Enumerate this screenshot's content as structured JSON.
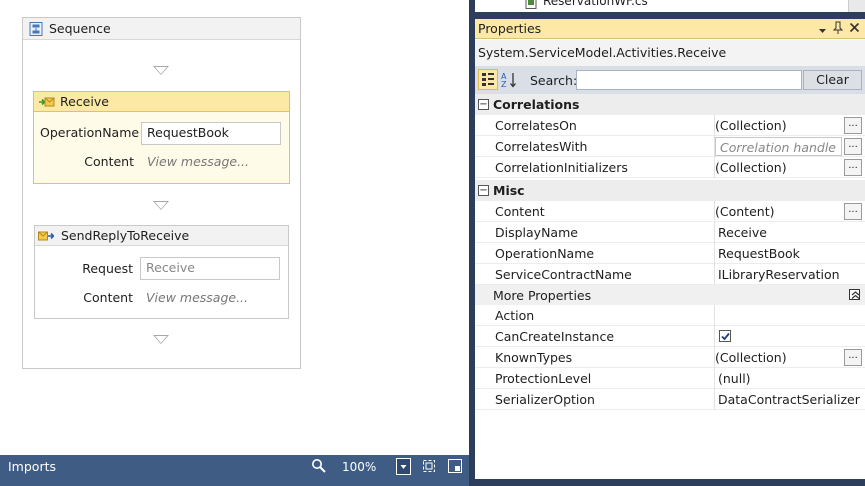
{
  "designer": {
    "sequence_title": "Sequence",
    "receive": {
      "title": "Receive",
      "operation_label": "OperationName",
      "operation_value": "RequestBook",
      "content_label": "Content",
      "content_hint": "View message..."
    },
    "send_reply": {
      "title": "SendReplyToReceive",
      "request_label": "Request",
      "request_value": "Receive",
      "content_label": "Content",
      "content_hint": "View message..."
    }
  },
  "statusbar": {
    "imports_label": "Imports",
    "zoom": "100%"
  },
  "properties": {
    "solution_item": "ReservationWF.cs",
    "title": "Properties",
    "type_name": "System.ServiceModel.Activities.Receive",
    "search_label": "Search:",
    "search_value": "",
    "clear_label": "Clear",
    "correlations_category": "Correlations",
    "misc_category": "Misc",
    "more_properties_label": "More Properties",
    "rows": {
      "correlates_on": {
        "name": "CorrelatesOn",
        "value": "(Collection)"
      },
      "correlates_with": {
        "name": "CorrelatesWith",
        "value": "Correlation handle"
      },
      "correlation_initializers": {
        "name": "CorrelationInitializers",
        "value": "(Collection)"
      },
      "content": {
        "name": "Content",
        "value": "(Content)"
      },
      "display_name": {
        "name": "DisplayName",
        "value": "Receive"
      },
      "operation_name": {
        "name": "OperationName",
        "value": "RequestBook"
      },
      "service_contract_name": {
        "name": "ServiceContractName",
        "value": "ILibraryReservation"
      },
      "action": {
        "name": "Action",
        "value": ""
      },
      "can_create_instance": {
        "name": "CanCreateInstance",
        "checked": true
      },
      "known_types": {
        "name": "KnownTypes",
        "value": "(Collection)"
      },
      "protection_level": {
        "name": "ProtectionLevel",
        "value": "(null)"
      },
      "serializer_option": {
        "name": "SerializerOption",
        "value": "DataContractSerializer"
      }
    },
    "ellipsis": "..."
  },
  "colors": {
    "statusbar_bg": "#3f5c85",
    "properties_title_bg": "#fde9a5",
    "selected_activity_border": "#e6c25e"
  }
}
